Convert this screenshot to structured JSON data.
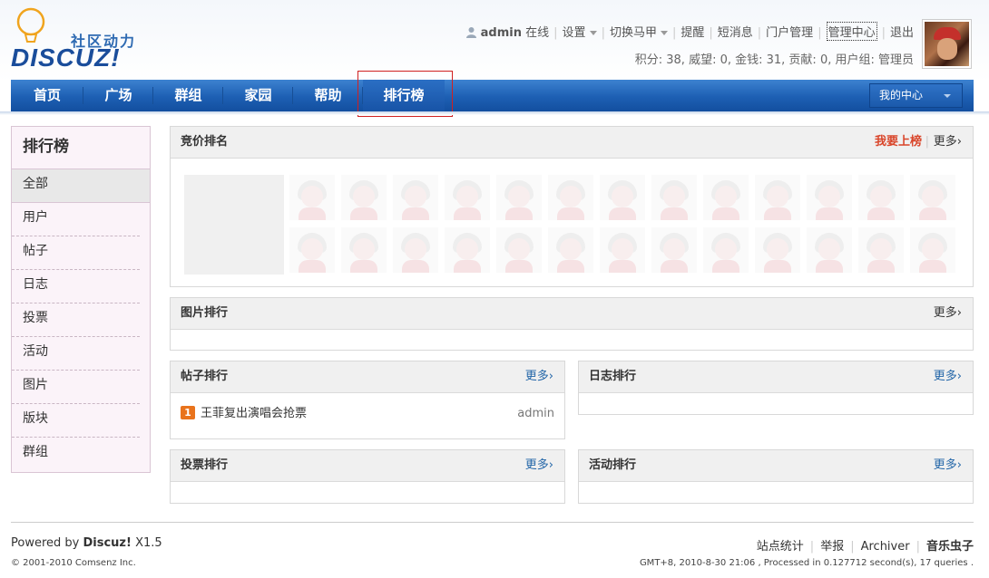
{
  "logo": {
    "tagline": "社区动力",
    "brand": "DISCUZ!"
  },
  "userbar": {
    "username": "admin",
    "status": "在线",
    "settings": "设置",
    "switch_vest": "切换马甲",
    "remind": "提醒",
    "messages": "短消息",
    "portal_manage": "门户管理",
    "admin_center": "管理中心",
    "logout": "退出"
  },
  "credits": "积分: 38, 威望: 0, 金钱: 31, 贡献: 0, 用户组: 管理员",
  "nav": {
    "items": [
      "首页",
      "广场",
      "群组",
      "家园",
      "帮助",
      "排行榜"
    ],
    "my_center": "我的中心"
  },
  "sidebar": {
    "title": "排行榜",
    "items": [
      "全部",
      "用户",
      "帖子",
      "日志",
      "投票",
      "活动",
      "图片",
      "版块",
      "群组"
    ]
  },
  "panels": {
    "bid": {
      "title": "竞价排名",
      "bid_link": "我要上榜",
      "more": "更多›"
    },
    "pictures": {
      "title": "图片排行",
      "more": "更多›"
    },
    "threads": {
      "title": "帖子排行",
      "more": "更多›",
      "rows": [
        {
          "rank": "1",
          "subject": "王菲复出演唱会抢票",
          "author": "admin"
        }
      ]
    },
    "blogs": {
      "title": "日志排行",
      "more": "更多›"
    },
    "polls": {
      "title": "投票排行",
      "more": "更多›"
    },
    "activities": {
      "title": "活动排行",
      "more": "更多›"
    }
  },
  "footer": {
    "powered_prefix": "Powered by ",
    "powered_brand": "Discuz!",
    "powered_version": " X1.5",
    "copyright": "© 2001-2010 Comsenz Inc.",
    "links": [
      "站点统计",
      "举报",
      "Archiver",
      "音乐虫子"
    ],
    "debug": "GMT+8, 2010-8-30 21:06 , Processed in 0.127712 second(s), 17 queries ."
  },
  "colors": {
    "nav_blue": "#1d5fb3",
    "accent_red": "#d9452a",
    "link_blue": "#2366a8",
    "sidebar_bg": "#fbf3f9"
  }
}
